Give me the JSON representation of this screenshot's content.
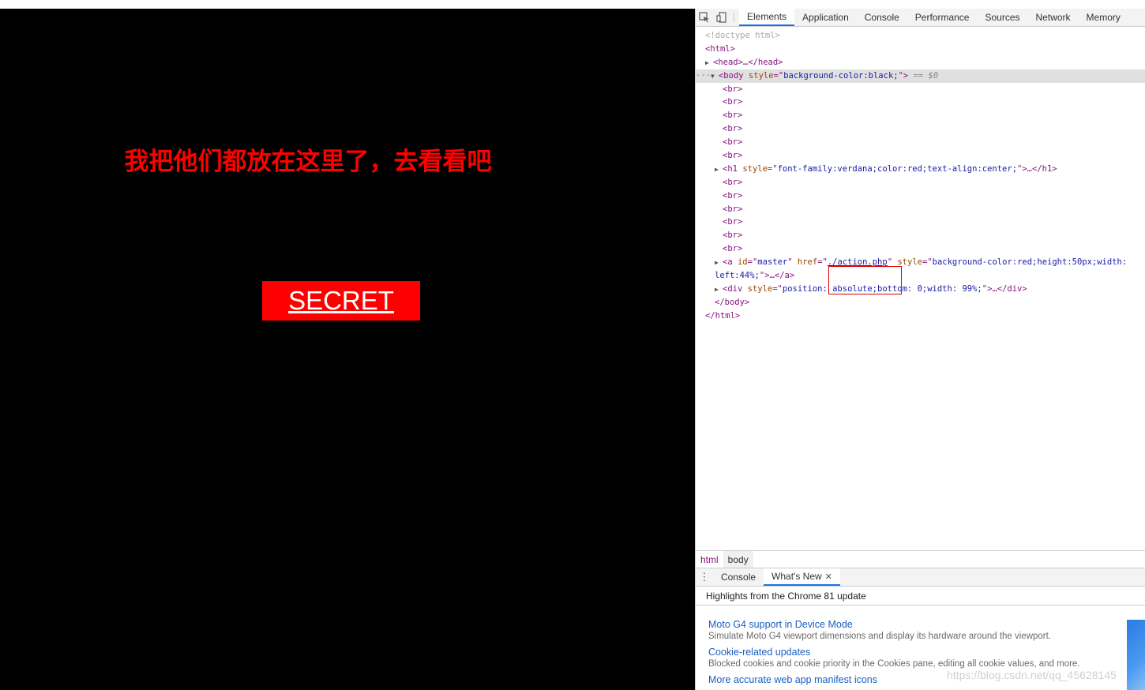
{
  "page": {
    "heading": "我把他们都放在这里了，去看看吧",
    "secret_link": "SECRET"
  },
  "devtools": {
    "tabs": [
      "Elements",
      "Application",
      "Console",
      "Performance",
      "Sources",
      "Network",
      "Memory"
    ],
    "active_tab": "Elements",
    "dom": {
      "doctype": "<!doctype html>",
      "html_open": "<html>",
      "head": "<head>…</head>",
      "body_tag": "body",
      "body_style_attr": "style",
      "body_style_val": "background-color:black;",
      "body_sel_marker": "== $0",
      "br": "<br>",
      "h1_tag": "h1",
      "h1_style_val": "font-family:verdana;color:red;text-align:center;",
      "h1_close": "…</h1>",
      "a_tag": "a",
      "a_id_attr": "id",
      "a_id_val": "master",
      "a_href_attr": "href",
      "a_href_val": "./action.php",
      "a_style_attr": "style",
      "a_style_val": "background-color:red;height:50px;width:",
      "a_style_cont": "left:44%;",
      "a_close": "…</a>",
      "div_tag": "div",
      "div_style_val": "position: absolute;bottom: 0;width: 99%;",
      "div_close": "…</div>",
      "body_close": "</body>",
      "html_close": "</html>"
    },
    "breadcrumbs": [
      "html",
      "body"
    ],
    "drawer": {
      "tabs": [
        "Console",
        "What's New"
      ],
      "active_tab": "What's New",
      "header": "Highlights from the Chrome 81 update",
      "items": [
        {
          "title": "Moto G4 support in Device Mode",
          "desc": "Simulate Moto G4 viewport dimensions and display its hardware around the viewport."
        },
        {
          "title": "Cookie-related updates",
          "desc": "Blocked cookies and cookie priority in the Cookies pane, editing all cookie values, and more."
        },
        {
          "title": "More accurate web app manifest icons",
          "desc": ""
        }
      ]
    }
  },
  "watermark": "https://blog.csdn.net/qq_45628145"
}
